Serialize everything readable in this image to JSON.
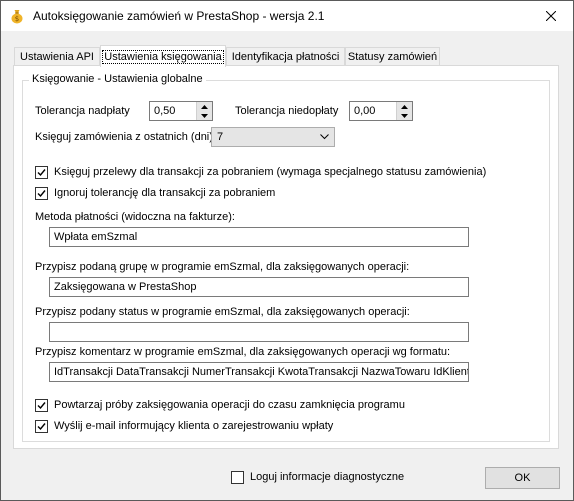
{
  "window": {
    "title": "Autoksięgowanie zamówień w PrestaShop - wersja 2.1",
    "icon": "money-bag-icon",
    "close_icon": "close-icon"
  },
  "tabs": [
    {
      "label": "Ustawienia API",
      "active": false
    },
    {
      "label": "Ustawienia księgowania",
      "active": true
    },
    {
      "label": "Identyfikacja płatności",
      "active": false
    },
    {
      "label": "Statusy zamówień",
      "active": false
    }
  ],
  "group": {
    "title": "Księgowanie - Ustawienia globalne",
    "overpay_label": "Tolerancja nadpłaty",
    "overpay_value": "0,50",
    "underpay_label": "Tolerancja niedopłaty",
    "underpay_value": "0,00",
    "days_label": "Księguj zamówienia z ostatnich (dni)",
    "days_value": "7",
    "cod_transfer_label": "Księguj przelewy dla transakcji za pobraniem (wymaga specjalnego statusu zamówienia)",
    "cod_transfer_checked": true,
    "cod_tolerance_label": "Ignoruj tolerancję dla transakcji za pobraniem",
    "cod_tolerance_checked": true,
    "payment_method_label": "Metoda płatności (widoczna na fakturze):",
    "payment_method_value": "Wpłata emSzmal",
    "group_label": "Przypisz podaną grupę w programie emSzmal, dla zaksięgowanych operacji:",
    "group_value": "Zaksięgowana w PrestaShop",
    "status_label": "Przypisz podany status w programie emSzmal, dla zaksięgowanych operacji:",
    "status_value": "",
    "comment_label": "Przypisz komentarz w programie emSzmal, dla zaksięgowanych operacji wg formatu:",
    "comment_value": "IdTransakcji DataTransakcji NumerTransakcji KwotaTransakcji NazwaTowaru IdKlienta",
    "retry_label": "Powtarzaj próby zaksięgowania operacji do czasu zamknięcia programu",
    "retry_checked": true,
    "email_label": "Wyślij e-mail informujący klienta o zarejestrowaniu wpłaty",
    "email_checked": true
  },
  "footer": {
    "diag_label": "Loguj informacje diagnostyczne",
    "diag_checked": false,
    "ok_label": "OK"
  }
}
